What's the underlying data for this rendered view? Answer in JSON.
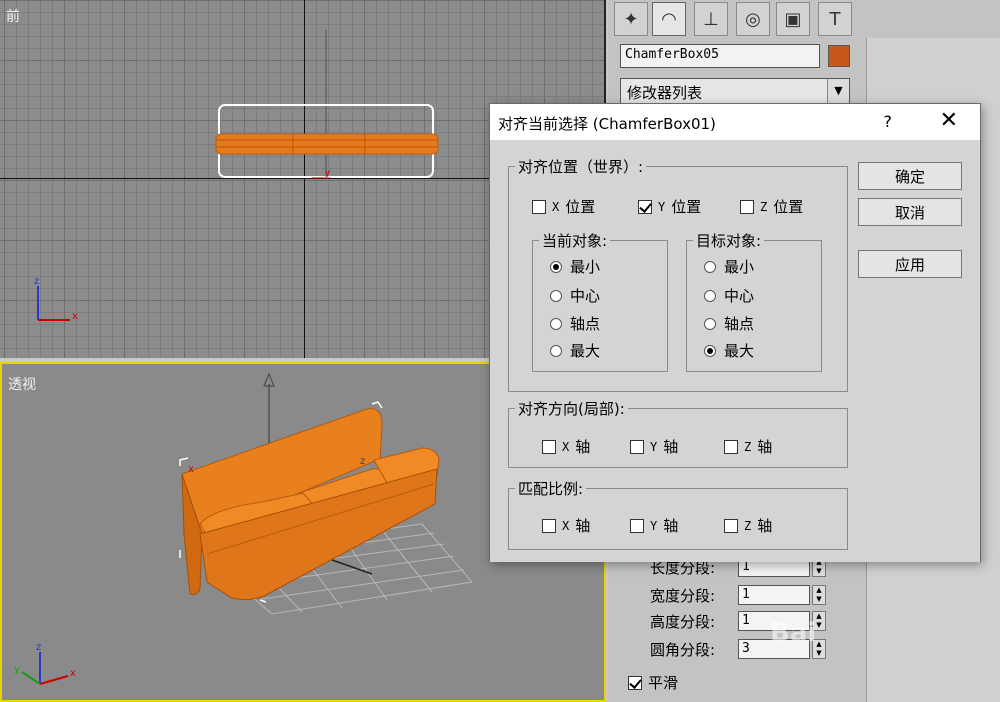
{
  "viewports": {
    "front_label": "前",
    "persp_label": "透视"
  },
  "command_panel": {
    "tabs": [
      "create-icon",
      "modify-icon",
      "hierarchy-icon",
      "motion-icon",
      "display-icon",
      "utilities-icon"
    ],
    "object_name": "ChamferBox05",
    "object_color": "#c8571b",
    "modifier_list": "修改器列表",
    "params": [
      {
        "label": "长度分段:",
        "value": "1"
      },
      {
        "label": "宽度分段:",
        "value": "1"
      },
      {
        "label": "高度分段:",
        "value": "1"
      },
      {
        "label": "圆角分段:",
        "value": "3"
      }
    ],
    "smooth_label": "平滑"
  },
  "dialog": {
    "title": "对齐当前选择 (ChamferBox01)",
    "help": "?",
    "close": "✕",
    "align_position": {
      "legend": "对齐位置（世界）:",
      "x_label": "位置",
      "y_label": "位置",
      "z_label": "位置",
      "x_axis": "X",
      "y_axis": "Y",
      "z_axis": "Z",
      "x_checked": false,
      "y_checked": true,
      "z_checked": false
    },
    "current_object": {
      "legend": "当前对象:",
      "options": [
        "最小",
        "中心",
        "轴点",
        "最大"
      ],
      "selected": "最小"
    },
    "target_object": {
      "legend": "目标对象:",
      "options": [
        "最小",
        "中心",
        "轴点",
        "最大"
      ],
      "selected": "最大"
    },
    "align_orientation": {
      "legend": "对齐方向(局部):",
      "x_label": "轴",
      "y_label": "轴",
      "z_label": "轴",
      "x_axis": "X",
      "y_axis": "Y",
      "z_axis": "Z"
    },
    "match_scale": {
      "legend": "匹配比例:",
      "x_label": "轴",
      "y_label": "轴",
      "z_label": "轴",
      "x_axis": "X",
      "y_axis": "Y",
      "z_axis": "Z"
    },
    "buttons": {
      "ok": "确定",
      "cancel": "取消",
      "apply": "应用"
    }
  },
  "watermark": "Bai"
}
